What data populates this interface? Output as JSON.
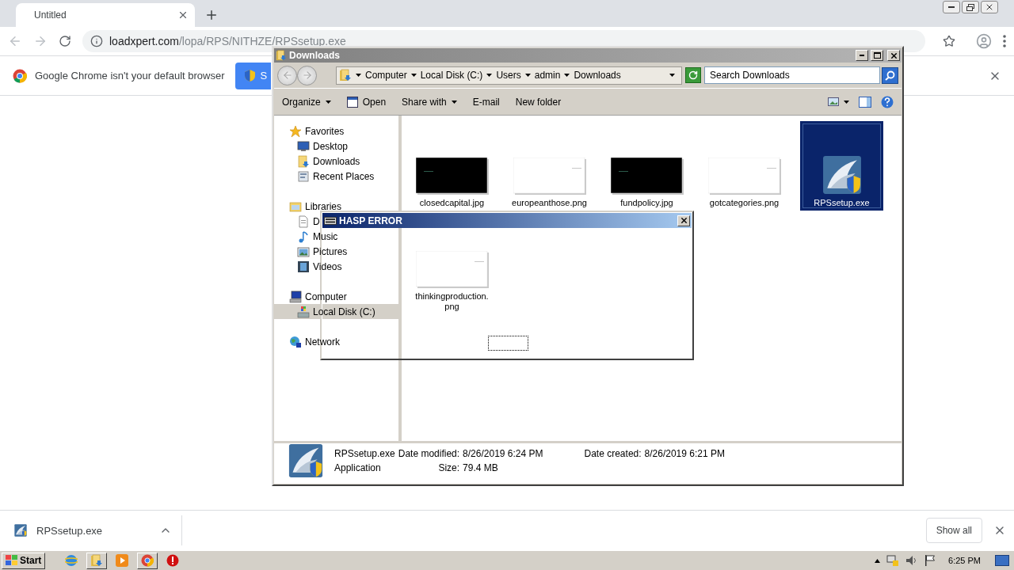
{
  "browser": {
    "tab": {
      "title": "Untitled"
    },
    "url": {
      "host": "loadxpert.com",
      "path": "/lopa/RPS/NITHZE/RPSsetup.exe"
    },
    "infobar": {
      "message": "Google Chrome isn't your default browser",
      "button": "S"
    },
    "downloads": {
      "file": "RPSsetup.exe",
      "show_all": "Show all"
    }
  },
  "explorer": {
    "title": "Downloads",
    "breadcrumbs": [
      "Computer",
      "Local Disk (C:)",
      "Users",
      "admin",
      "Downloads"
    ],
    "search": {
      "placeholder": "Search Downloads"
    },
    "toolbar": [
      {
        "label": "Organize",
        "kind": "menu"
      },
      {
        "label": "Open",
        "kind": "icon"
      },
      {
        "label": "Share with",
        "kind": "menu"
      },
      {
        "label": "E-mail",
        "kind": "plain"
      },
      {
        "label": "New folder",
        "kind": "plain"
      }
    ],
    "nav": [
      {
        "label": "Favorites",
        "kind": "star",
        "selected": false,
        "children": [
          {
            "label": "Desktop",
            "kind": "desktop",
            "selected": false
          },
          {
            "label": "Downloads",
            "kind": "folder",
            "selected": false
          },
          {
            "label": "Recent Places",
            "kind": "recent",
            "selected": false
          }
        ]
      },
      {
        "label": "Libraries",
        "kind": "library",
        "selected": false,
        "children": [
          {
            "label": "D",
            "kind": "document",
            "selected": false
          },
          {
            "label": "Music",
            "kind": "music",
            "selected": false
          },
          {
            "label": "Pictures",
            "kind": "pictures",
            "selected": false
          },
          {
            "label": "Videos",
            "kind": "videos",
            "selected": false
          }
        ]
      },
      {
        "label": "Computer",
        "kind": "computer",
        "selected": false,
        "children": [
          {
            "label": "Local Disk (C:)",
            "kind": "disk",
            "selected": true
          }
        ]
      },
      {
        "label": "Network",
        "kind": "network",
        "selected": false
      }
    ],
    "files": [
      {
        "name": "closedcapital.jpg",
        "kind": "dark",
        "selected": false
      },
      {
        "name": "europeanthose.png",
        "kind": "light",
        "selected": false
      },
      {
        "name": "fundpolicy.jpg",
        "kind": "dark",
        "selected": false
      },
      {
        "name": "gotcategories.png",
        "kind": "light",
        "selected": false
      },
      {
        "name": "RPSsetup.exe",
        "kind": "app",
        "selected": true
      },
      {
        "name": "thinkingproduction.png",
        "kind": "light",
        "selected": false
      }
    ],
    "details": {
      "name": "RPSsetup.exe",
      "type": "Application",
      "modified": {
        "label": "Date modified:",
        "value": "8/26/2019 6:24 PM"
      },
      "created": {
        "label": "Date created:",
        "value": "8/26/2019 6:21 PM"
      },
      "size": {
        "label": "Size:",
        "value": "79.4 MB"
      }
    }
  },
  "dialog": {
    "title": "HASP ERROR"
  },
  "taskbar": {
    "start": "Start",
    "clock": "6:25 PM"
  }
}
